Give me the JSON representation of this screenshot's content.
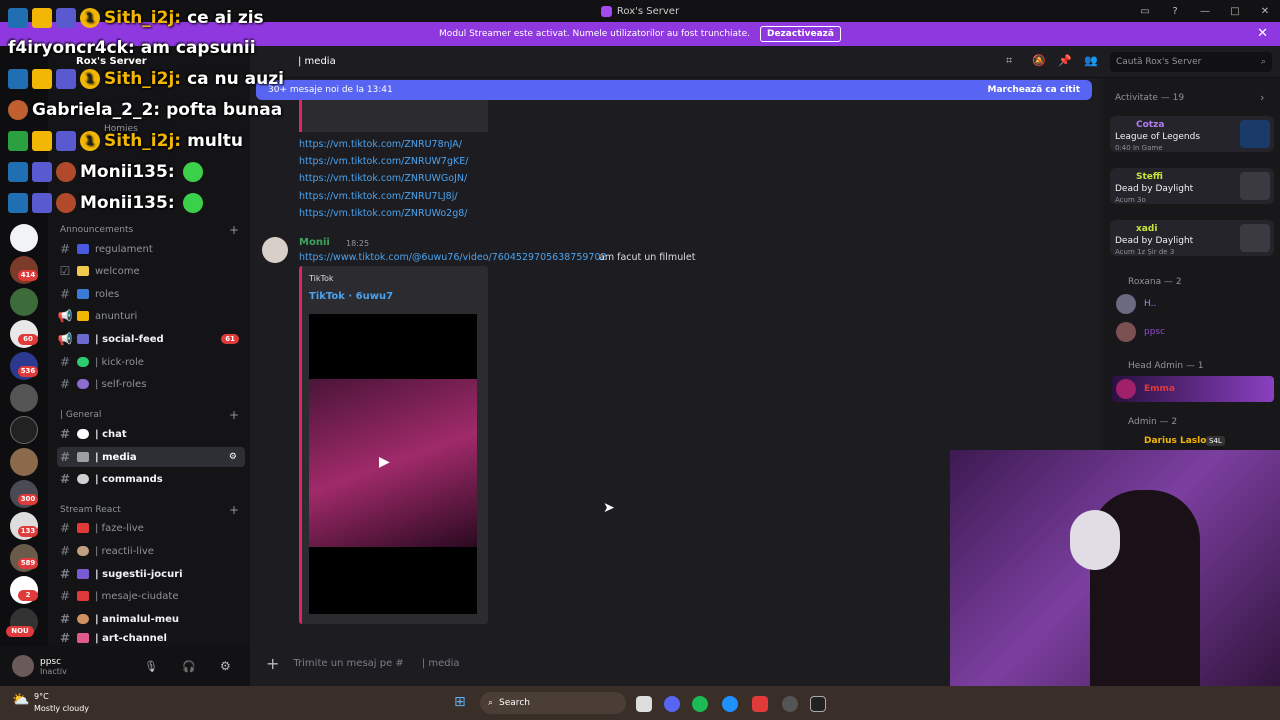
{
  "titlebar": {
    "title": "Rox's Server"
  },
  "banner": {
    "text": "Modul Streamer este activat. Numele utilizatorilor au fost trunchiate.",
    "button": "Dezactivează"
  },
  "server": {
    "name": "Rox's Server"
  },
  "channel": {
    "name": "| media"
  },
  "new_messages": {
    "text": "30+ mesaje noi de la 13:41",
    "mark_read": "Marchează ca citit"
  },
  "search": {
    "placeholder": "Caută Rox's Server"
  },
  "sidebar": {
    "section_homies": "Homies",
    "category_announcements": "Announcements",
    "announcements": [
      {
        "label": "regulament",
        "bright": false
      },
      {
        "label": "welcome",
        "bright": false
      },
      {
        "label": "roles",
        "bright": false
      },
      {
        "label": "anunturi",
        "bright": false
      },
      {
        "label": "| social-feed",
        "bright": true,
        "badge": "61"
      },
      {
        "label": "| kick-role",
        "bright": false
      },
      {
        "label": "| self-roles",
        "bright": false
      }
    ],
    "category_general": "| General",
    "general": [
      {
        "label": "| chat",
        "bright": true
      },
      {
        "label": "| media",
        "bright": true,
        "selected": true
      },
      {
        "label": "| commands",
        "bright": true
      }
    ],
    "category_stream": "Stream React",
    "stream": [
      {
        "label": "| faze-live",
        "bright": false
      },
      {
        "label": "| reactii-live",
        "bright": false
      },
      {
        "label": "| sugestii-jocuri",
        "bright": true
      },
      {
        "label": "| mesaje-ciudate",
        "bright": false
      },
      {
        "label": "| animalul-meu",
        "bright": true
      },
      {
        "label": "| art-channel",
        "bright": true
      }
    ],
    "server_badges": [
      "414",
      "60",
      "536",
      "300",
      "133",
      "589",
      "2"
    ],
    "new_label": "NOU"
  },
  "user": {
    "name": "ppsc",
    "status": "Inactiv"
  },
  "messages": {
    "links": [
      "https://vm.tiktok.com/ZNRU78nJA/",
      "https://vm.tiktok.com/ZNRUW7gKE/",
      "https://vm.tiktok.com/ZNRUWGoJN/",
      "https://vm.tiktok.com/ZNRU7LJ8j/",
      "https://vm.tiktok.com/ZNRUWo2g8/"
    ],
    "author": "Monii",
    "time": "18:25",
    "link": "https://www.tiktok.com/@6uwu76/video/7604529705638759702",
    "text": "am facut un filmulet",
    "embed_provider": "TikTok",
    "embed_title": "TikTok · 6uwu7"
  },
  "composer": {
    "placeholder": "Trimite un mesaj pe #",
    "channel": "| media"
  },
  "members": {
    "activity_header": "Activitate — 19",
    "activities": [
      {
        "name": "Cotza",
        "game": "League of Legends",
        "sub": "0:40  In Game",
        "color": "#b27cf0"
      },
      {
        "name": "Steffi",
        "game": "Dead by Daylight",
        "sub": "Acum 3o",
        "color": "#c6e63a"
      },
      {
        "name": "xadi",
        "game": "Dead by Daylight",
        "sub": "Acum 1z  Șir de 3",
        "color": "#c6e63a"
      }
    ],
    "roxana_header": "Roxana — 2",
    "roxana_members": [
      "H..",
      "ppsc"
    ],
    "head_admin_header": "Head Admin — 1",
    "head_admin_member": "Emma",
    "admin_header": "Admin — 2",
    "admin_member": "Darius Laslo",
    "tag": "S4L"
  },
  "stream_chat": [
    {
      "user": "Sith_i2j:",
      "msg": "ce ai zis",
      "color": "#f2b705"
    },
    {
      "user": "f4iryoncr4ck:",
      "msg": "am capsunii",
      "color": "#ffffff"
    },
    {
      "user": "Sith_i2j:",
      "msg": "ca nu auzi",
      "color": "#f2b705"
    },
    {
      "user": "Gabriela_2_2:",
      "msg": "pofta bunaa",
      "color": "#ffffff"
    },
    {
      "user": "Sith_i2j:",
      "msg": "multu",
      "color": "#f2b705"
    },
    {
      "user": "Monii135:",
      "msg": "",
      "color": "#ffffff"
    },
    {
      "user": "Monii135:",
      "msg": "",
      "color": "#ffffff"
    }
  ],
  "weather": {
    "temp": "9°C",
    "desc": "Mostly cloudy"
  },
  "taskbar": {
    "search": "Search"
  },
  "colors": {
    "accent": "#5865f2",
    "banner": "#8f38e0",
    "link": "#4aa3f0",
    "embed_border": "#e0245e"
  }
}
